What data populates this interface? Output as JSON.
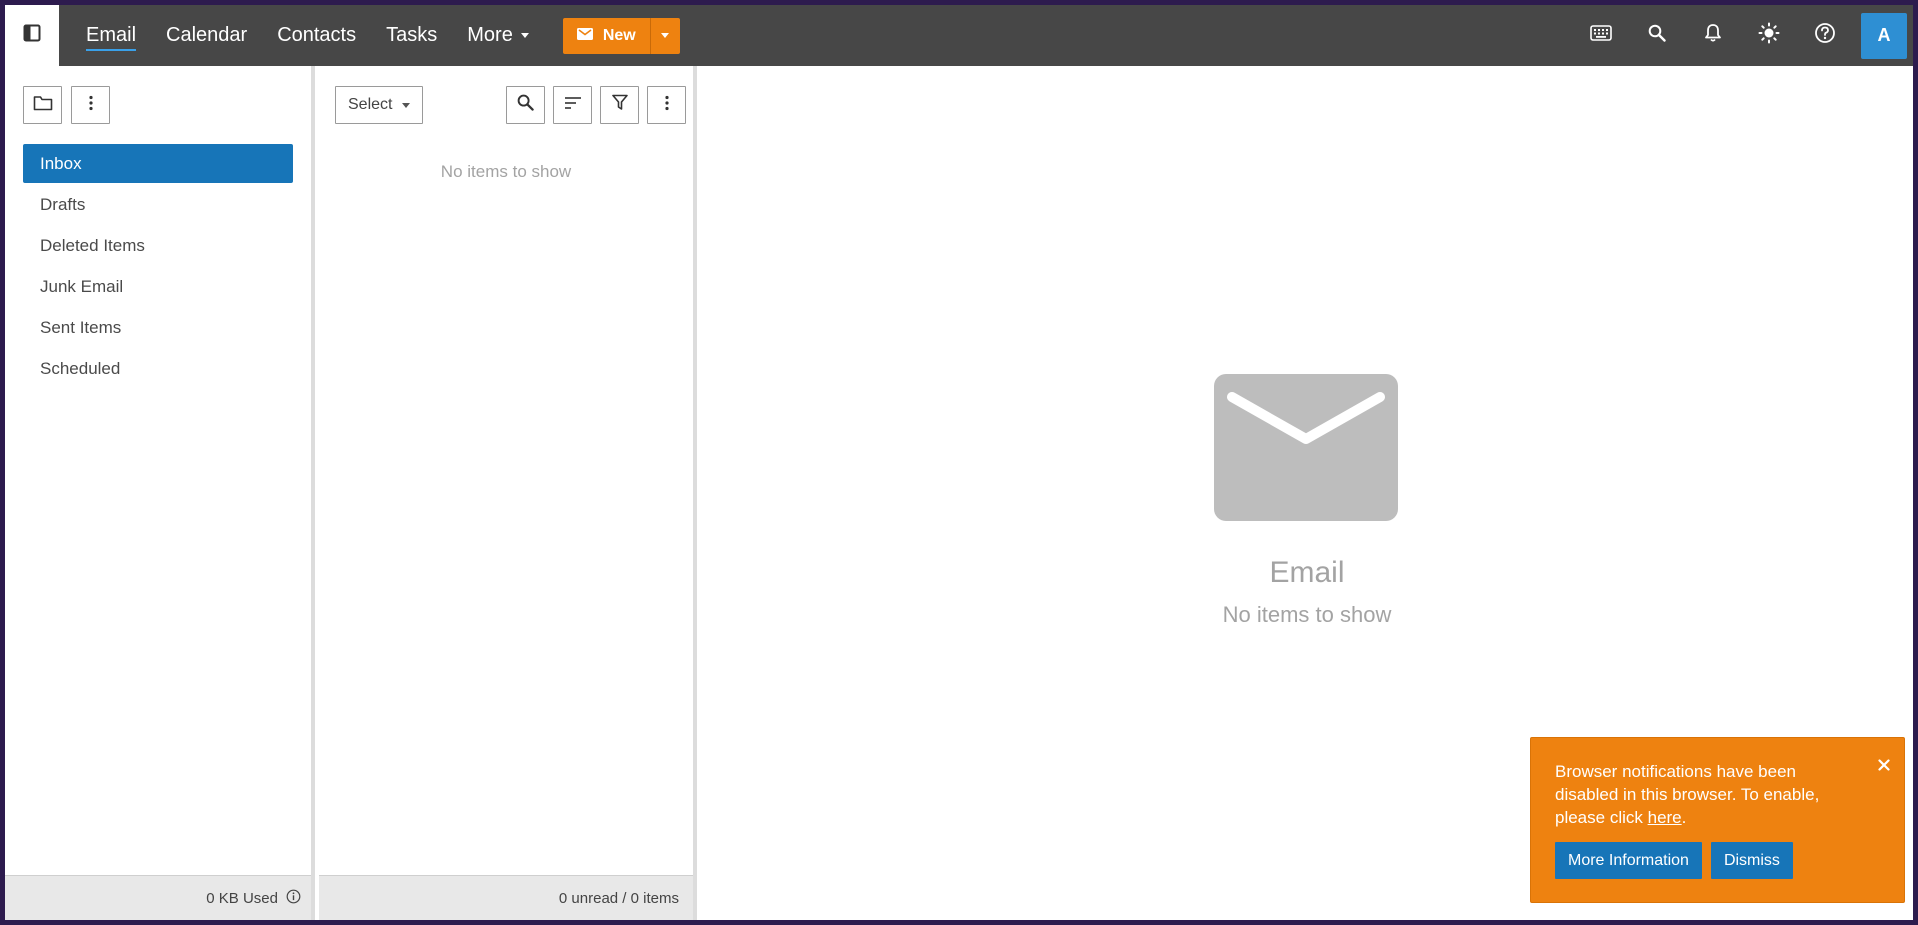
{
  "nav": {
    "items": [
      {
        "label": "Email",
        "active": true
      },
      {
        "label": "Calendar"
      },
      {
        "label": "Contacts"
      },
      {
        "label": "Tasks"
      },
      {
        "label": "More"
      }
    ],
    "new_button": "New",
    "avatar_initial": "A",
    "icons": [
      "sidebar-toggle-icon",
      "keyboard-icon",
      "search-icon",
      "bell-icon",
      "sun-icon",
      "help-icon"
    ]
  },
  "folders": {
    "items": [
      {
        "label": "Inbox",
        "selected": true
      },
      {
        "label": "Drafts"
      },
      {
        "label": "Deleted Items"
      },
      {
        "label": "Junk Email"
      },
      {
        "label": "Sent Items"
      },
      {
        "label": "Scheduled"
      }
    ],
    "footer": "0 KB Used"
  },
  "message_list": {
    "select_label": "Select",
    "empty_text": "No items to show",
    "footer": "0 unread / 0 items"
  },
  "reading_pane": {
    "title": "Email",
    "subtitle": "No items to show"
  },
  "toast": {
    "text_before": "Browser notifications have been disabled in this browser. To enable, please click ",
    "link": "here",
    "text_after": ".",
    "more_info": "More Information",
    "dismiss": "Dismiss"
  },
  "colors": {
    "topbar": "#474747",
    "accent_orange": "#ee8210",
    "selected_blue": "#1775b8",
    "avatar_blue": "#2e8fd3"
  }
}
